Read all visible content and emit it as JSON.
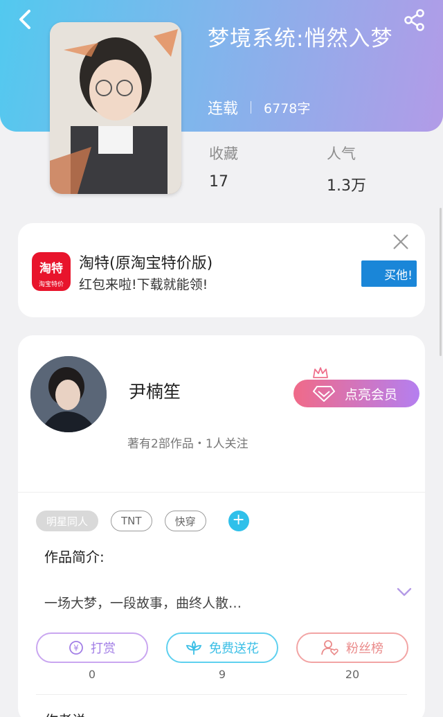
{
  "header": {
    "book_title": "梦境系统:悄然入梦",
    "status": "连载",
    "word_count": "6778字"
  },
  "stats": {
    "favorites_label": "收藏",
    "favorites_value": "17",
    "popularity_label": "人气",
    "popularity_value": "1.3万"
  },
  "ad": {
    "app_name": "淘特(原淘宝特价版)",
    "tagline": "红包来啦!下载就能领!",
    "logo_main": "淘特",
    "logo_sub": "淘宝特价",
    "cta": "买他!"
  },
  "author": {
    "name": "尹楠笙",
    "info": "著有2部作品・1人关注",
    "vip_label": "点亮会员"
  },
  "tags": [
    "明星同人",
    "TNT",
    "快穿"
  ],
  "intro": {
    "label": "作品简介:",
    "text": "一场大梦，一段故事，曲终人散…"
  },
  "actions": {
    "reward_label": "打赏",
    "reward_count": "0",
    "flower_label": "免费送花",
    "flower_count": "9",
    "fans_label": "粉丝榜",
    "fans_count": "20"
  },
  "next_heading": "作者说",
  "colors": {
    "header_gradient_start": "#52c9ef",
    "header_gradient_end": "#b29be7",
    "accent_blue": "#2fc0ea",
    "ad_red": "#e8142c"
  }
}
